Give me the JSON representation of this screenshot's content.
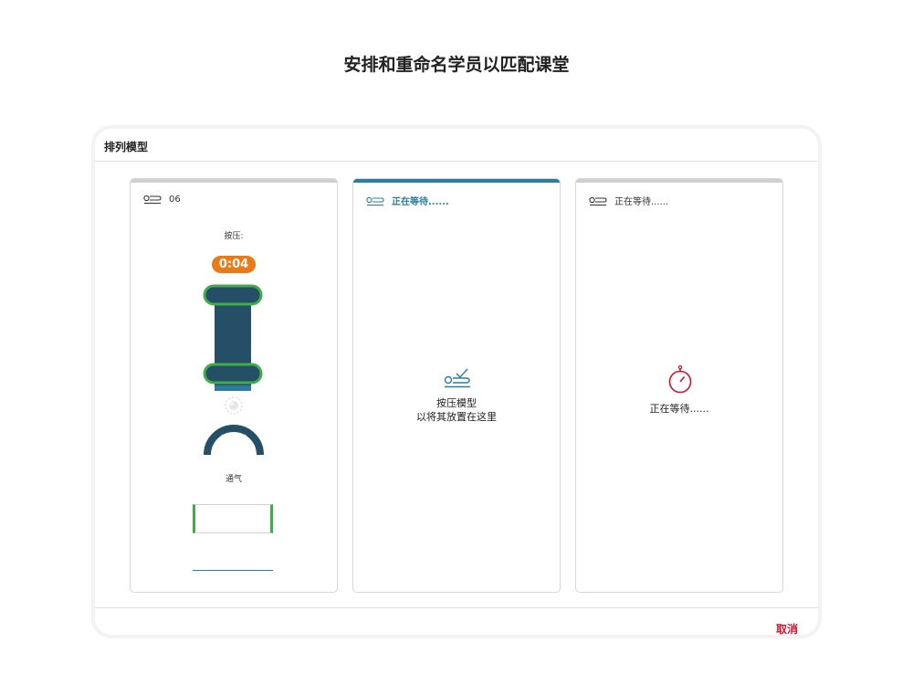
{
  "page": {
    "title": "安排和重命名学员以匹配课堂"
  },
  "dialog": {
    "title": "排列模型",
    "cancel_label": "取消"
  },
  "slots": [
    {
      "header_label": "06",
      "compression_label": "按压:",
      "timer": "0:04",
      "ventilation_label": "通气",
      "state": "connected"
    },
    {
      "header_label": "正在等待......",
      "message_line1": "按压模型",
      "message_line2": "以将其放置在这里",
      "state": "waiting-active"
    },
    {
      "header_label": "正在等待......",
      "message": "正在等待......",
      "state": "waiting"
    }
  ],
  "colors": {
    "accent_blue": "#2c7ea0",
    "timer_orange": "#ea7a16",
    "cancel_red": "#d0142b",
    "compression_dark": "#244f66",
    "good_green": "#3fae49"
  },
  "icons": {
    "mannequin": "mannequin-icon",
    "compress_check": "compress-check-icon",
    "stopwatch": "stopwatch-icon"
  }
}
